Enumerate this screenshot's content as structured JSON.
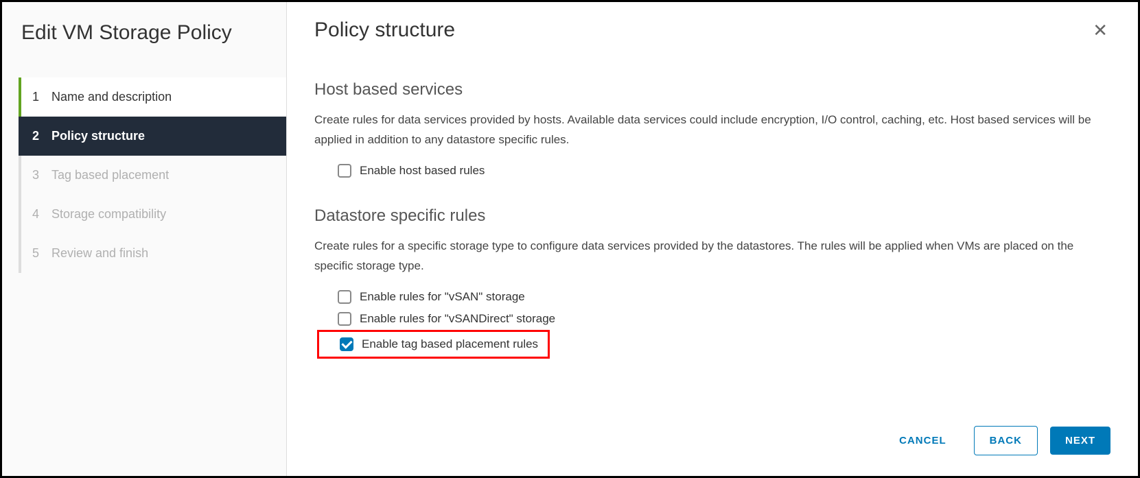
{
  "sidebar": {
    "title": "Edit VM Storage Policy",
    "steps": [
      {
        "num": "1",
        "label": "Name and description",
        "state": "completed"
      },
      {
        "num": "2",
        "label": "Policy structure",
        "state": "active"
      },
      {
        "num": "3",
        "label": "Tag based placement",
        "state": "disabled"
      },
      {
        "num": "4",
        "label": "Storage compatibility",
        "state": "disabled"
      },
      {
        "num": "5",
        "label": "Review and finish",
        "state": "disabled"
      }
    ]
  },
  "content": {
    "title": "Policy structure",
    "host_section": {
      "title": "Host based services",
      "desc": "Create rules for data services provided by hosts. Available data services could include encryption, I/O control, caching, etc. Host based services will be applied in addition to any datastore specific rules.",
      "checkbox_label": "Enable host based rules",
      "checkbox_checked": false
    },
    "datastore_section": {
      "title": "Datastore specific rules",
      "desc": "Create rules for a specific storage type to configure data services provided by the datastores. The rules will be applied when VMs are placed on the specific storage type.",
      "options": [
        {
          "label": "Enable rules for \"vSAN\" storage",
          "checked": false
        },
        {
          "label": "Enable rules for \"vSANDirect\" storage",
          "checked": false
        },
        {
          "label": "Enable tag based placement rules",
          "checked": true,
          "highlighted": true
        }
      ]
    }
  },
  "footer": {
    "cancel": "CANCEL",
    "back": "BACK",
    "next": "NEXT"
  }
}
